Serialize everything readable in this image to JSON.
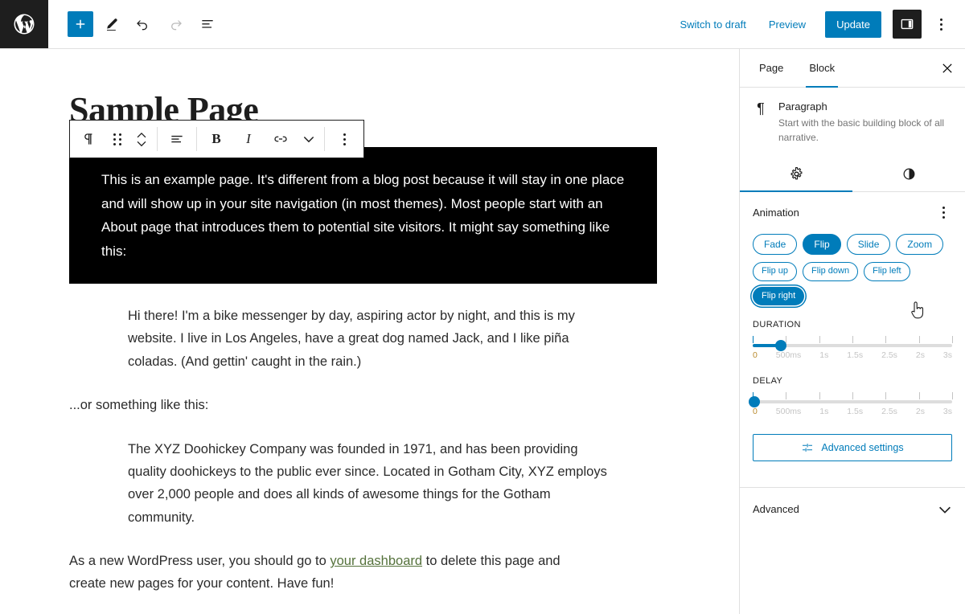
{
  "topbar": {
    "logo_icon": "wordpress-logo-icon",
    "add_block_icon": "plus-icon",
    "edit_icon": "pencil-icon",
    "undo_icon": "undo-icon",
    "redo_icon": "redo-icon",
    "list_view_icon": "list-view-icon",
    "switch_to_draft": "Switch to draft",
    "preview": "Preview",
    "update": "Update",
    "sidebar_toggle_icon": "sidebar-panel-icon",
    "options_icon": "more-options-icon",
    "accent_color": "#007cba",
    "dark_color": "#1e1e1e"
  },
  "block_toolbar": {
    "paragraph_icon": "paragraph-icon",
    "drag_icon": "drag-handle-icon",
    "move_icon": "move-up-down-icon",
    "align_icon": "align-text-icon",
    "bold": "B",
    "italic": "I",
    "link_icon": "link-icon",
    "more_formats_icon": "chevron-down-icon",
    "options_icon": "more-options-icon"
  },
  "editor": {
    "title": "Sample Page",
    "selected_block_text": "This is an example page. It's different from a blog post because it will stay in one place and will show up in your site navigation (in most themes). Most people start with an About page that introduces them to potential site visitors. It might say something like this:",
    "selected_block_bg": "#000000",
    "selected_block_color": "#ffffff",
    "quote_one": "Hi there! I'm a bike messenger by day, aspiring actor by night, and this is my website. I live in Los Angeles, have a great dog named Jack, and I like piña coladas. (And gettin' caught in the rain.)",
    "or_line": "...or something like this:",
    "quote_two": "The XYZ Doohickey Company was founded in 1971, and has been providing quality doohickeys to the public ever since. Located in Gotham City, XYZ employs over 2,000 people and does all kinds of awesome things for the Gotham community.",
    "final_prefix": "As a new WordPress user, you should go to ",
    "final_link": "your dashboard",
    "final_suffix": " to delete this page and create new pages for your content. Have fun!",
    "link_color": "#55723c"
  },
  "sidebar": {
    "tabs": [
      {
        "label": "Page",
        "active": false
      },
      {
        "label": "Block",
        "active": true
      }
    ],
    "close_icon": "close-icon",
    "block": {
      "icon": "paragraph-icon",
      "glyph": "¶",
      "title": "Paragraph",
      "description": "Start with the basic building block of all narrative."
    },
    "inspector_tabs": [
      {
        "icon": "gear-icon",
        "label": "Settings",
        "active": true
      },
      {
        "icon": "styles-contrast-icon",
        "label": "Styles",
        "active": false
      }
    ],
    "animation_panel": {
      "title": "Animation",
      "options_icon": "more-options-icon",
      "types": [
        {
          "label": "Fade",
          "active": false
        },
        {
          "label": "Flip",
          "active": true
        },
        {
          "label": "Slide",
          "active": false
        },
        {
          "label": "Zoom",
          "active": false
        }
      ],
      "directions": [
        {
          "label": "Flip up",
          "active": false,
          "focused": false
        },
        {
          "label": "Flip down",
          "active": false,
          "focused": false
        },
        {
          "label": "Flip left",
          "active": false,
          "focused": false
        },
        {
          "label": "Flip right",
          "active": true,
          "focused": true
        }
      ],
      "duration": {
        "label": "DURATION",
        "value": "500ms",
        "value_percent": 14.3,
        "ticks": [
          "0",
          "500ms",
          "1s",
          "1.5s",
          "2.5s",
          "2s",
          "3s"
        ]
      },
      "delay": {
        "label": "DELAY",
        "value": "0",
        "value_percent": 0,
        "ticks": [
          "0",
          "500ms",
          "1s",
          "1.5s",
          "2.5s",
          "2s",
          "3s"
        ]
      },
      "advanced_settings_button": "Advanced settings",
      "advanced_settings_icon": "sliders-icon"
    },
    "advanced_section": {
      "title": "Advanced",
      "chevron_icon": "chevron-down-icon"
    }
  },
  "cursor": {
    "icon": "pointing-hand-cursor"
  }
}
